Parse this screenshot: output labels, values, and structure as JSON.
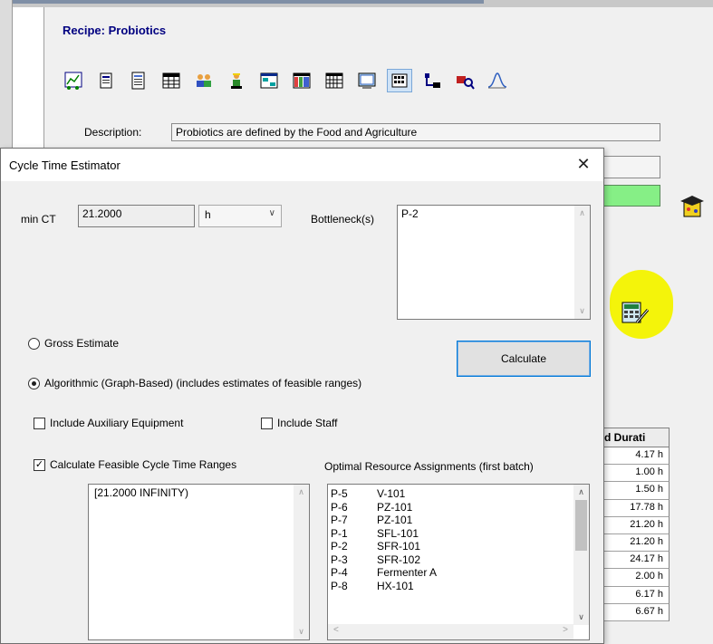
{
  "background_window": {
    "recipe_label": "Recipe:",
    "recipe_name": "Probiotics",
    "toolbar_icons": [
      "chart-icon",
      "document-icon",
      "list-icon",
      "table-icon",
      "people-icon",
      "worker-icon",
      "window-icon",
      "color-table-icon",
      "grid-icon",
      "display-icon",
      "calendar-grid-icon",
      "flow-icon",
      "search-tools-icon",
      "curve-icon"
    ],
    "description_label": "Description:",
    "description_value": "Probiotics are defined by the Food and Agriculture",
    "grid_header": "d Durati",
    "durations": [
      "4.17 h",
      "1.00 h",
      "1.50 h",
      "17.78 h",
      "21.20 h",
      "21.20 h",
      "24.17 h",
      "2.00 h",
      "6.17 h",
      "6.67 h"
    ]
  },
  "dialog": {
    "title": "Cycle Time Estimator",
    "close_symbol": "✕",
    "min_ct_label": "min CT",
    "min_ct_value": "21.2000",
    "unit_value": "h",
    "bottleneck_label": "Bottleneck(s)",
    "bottleneck_value": "P-2",
    "gross_estimate_label": "Gross Estimate",
    "algorithmic_label": "Algorithmic (Graph-Based) (includes estimates of feasible ranges)",
    "calculate_label": "Calculate",
    "include_aux_label": "Include Auxiliary Equipment",
    "include_staff_label": "Include Staff",
    "calc_ranges_label": "Calculate Feasible Cycle Time Ranges",
    "optimal_label": "Optimal Resource Assignments (first batch)",
    "range_value": "[21.2000   INFINITY)",
    "assignments": [
      {
        "proc": "P-5",
        "unit": "V-101"
      },
      {
        "proc": "P-6",
        "unit": "PZ-101"
      },
      {
        "proc": "P-7",
        "unit": "PZ-101"
      },
      {
        "proc": "P-1",
        "unit": "SFL-101"
      },
      {
        "proc": "P-2",
        "unit": "SFR-101"
      },
      {
        "proc": "P-3",
        "unit": "SFR-102"
      },
      {
        "proc": "P-4",
        "unit": "Fermenter A"
      },
      {
        "proc": "P-8",
        "unit": "HX-101"
      }
    ],
    "gross_selected": false,
    "algorithmic_selected": true,
    "include_aux_checked": false,
    "include_staff_checked": false,
    "calc_ranges_checked": true
  },
  "colors": {
    "title_blue": "#000080",
    "highlight_yellow": "#f4f40a",
    "status_green": "#86ef86",
    "button_border": "#0078d7"
  }
}
